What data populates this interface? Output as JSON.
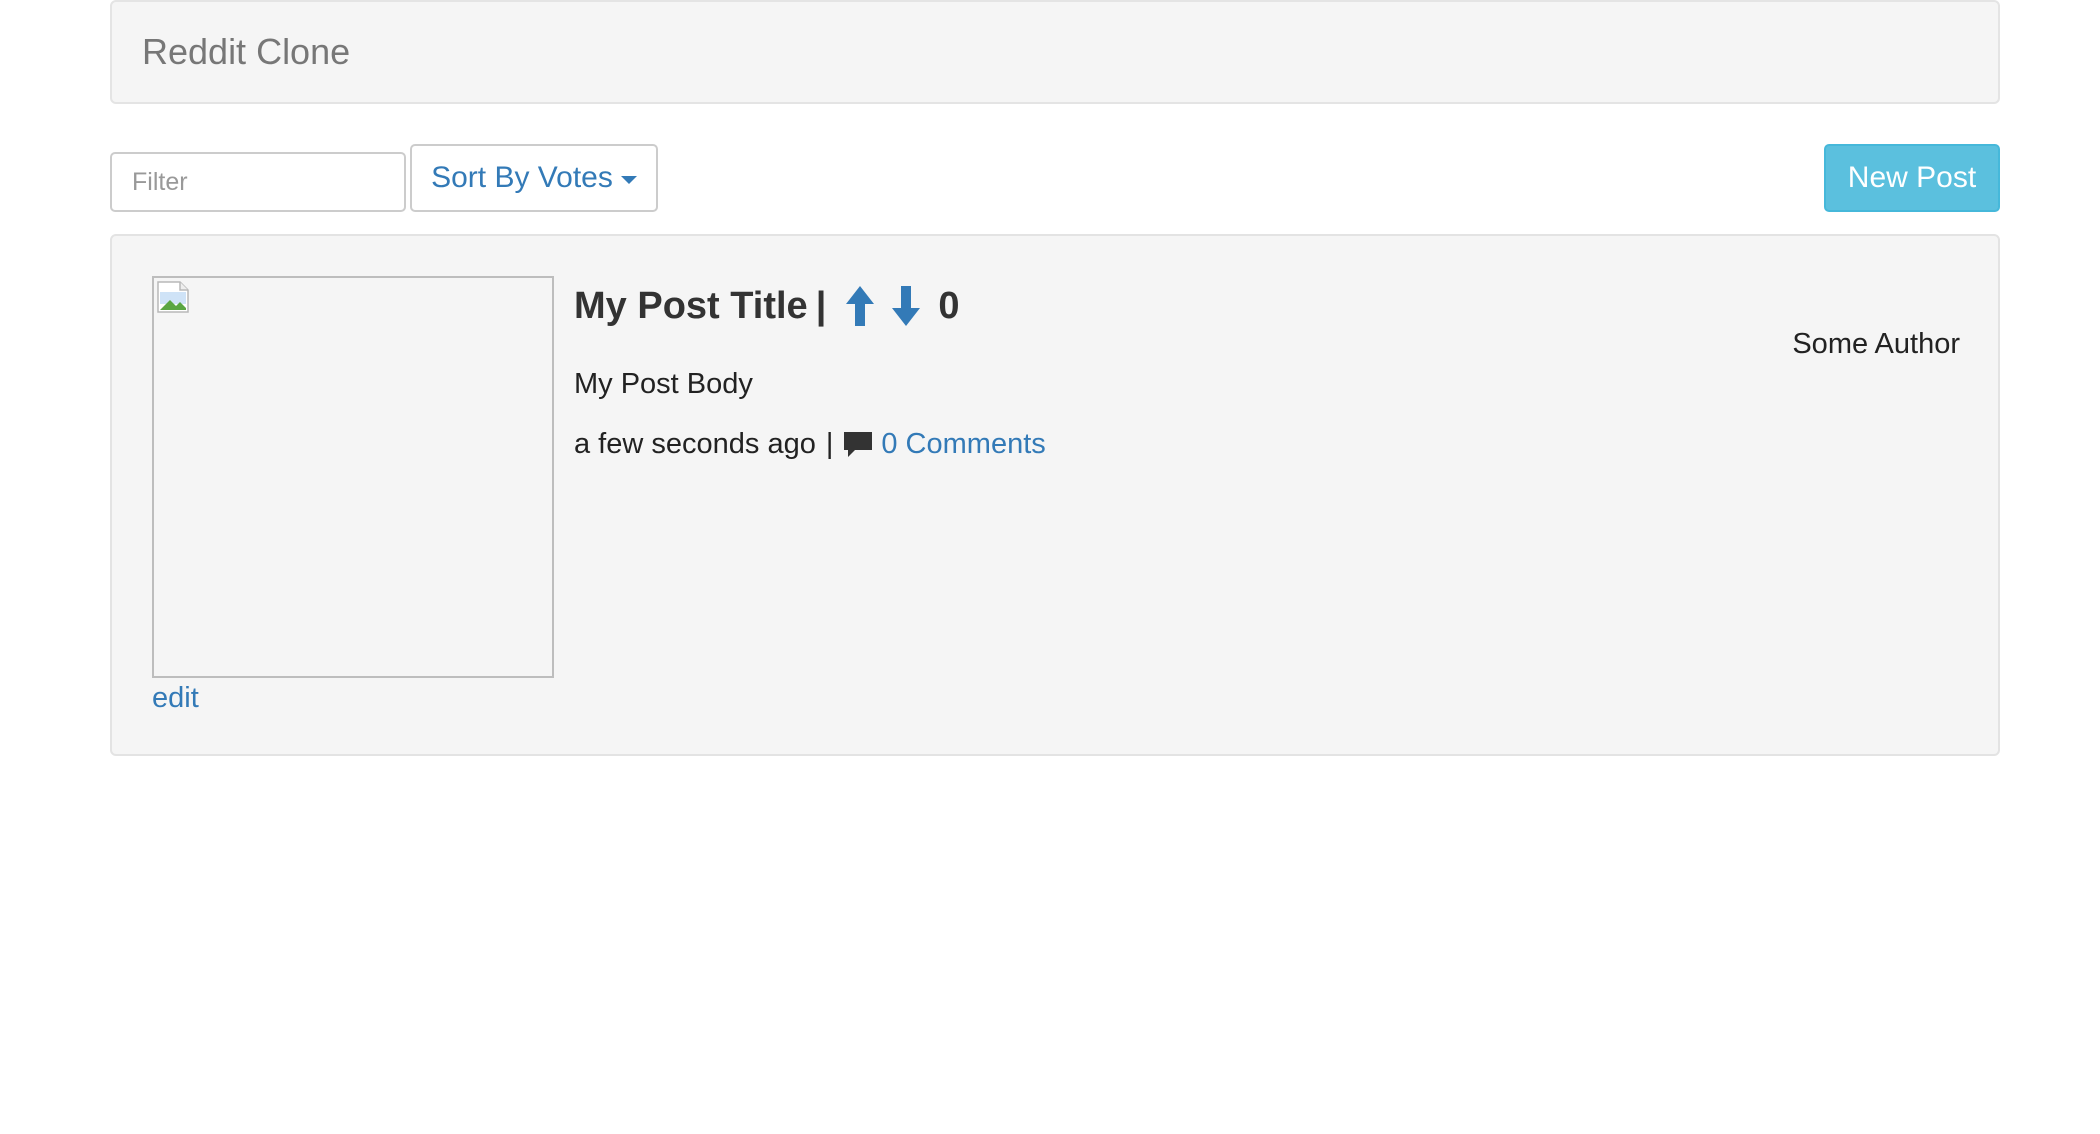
{
  "navbar": {
    "brand": "Reddit Clone"
  },
  "controls": {
    "filter_placeholder": "Filter",
    "filter_value": "",
    "sort_label": "Sort By Votes",
    "new_post_label": "New Post"
  },
  "posts": [
    {
      "title": "My Post Title",
      "title_separator": "|",
      "votes": "0",
      "author": "Some Author",
      "body": "My Post Body",
      "time": "a few seconds ago",
      "meta_separator": "|",
      "comments_label": "0 Comments",
      "edit_label": "edit"
    }
  ],
  "icons": {
    "upvote": "arrow-up-icon",
    "downvote": "arrow-down-icon",
    "comment": "comment-icon",
    "sort_caret": "caret-down-icon",
    "broken_image": "broken-image-icon"
  },
  "colors": {
    "link": "#337ab7",
    "info_button": "#5bc0de",
    "well_background": "#f5f5f5",
    "brand_text": "#777777"
  }
}
